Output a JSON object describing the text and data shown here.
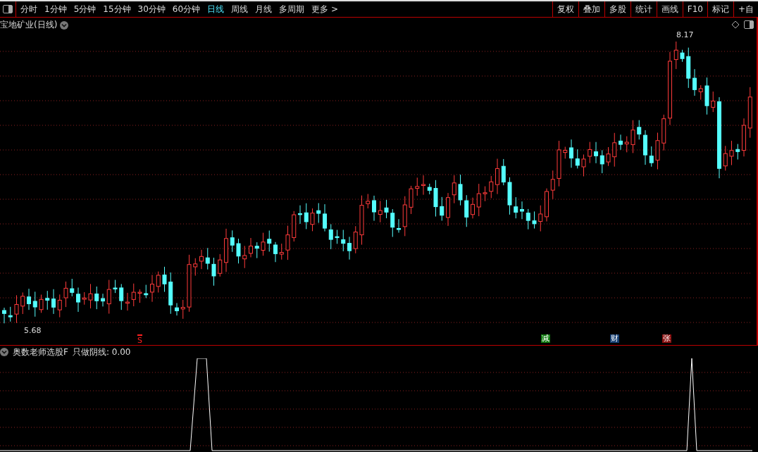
{
  "toolbar": {
    "periods": [
      {
        "label": "分时",
        "selected": false
      },
      {
        "label": "1分钟",
        "selected": false
      },
      {
        "label": "5分钟",
        "selected": false
      },
      {
        "label": "15分钟",
        "selected": false
      },
      {
        "label": "30分钟",
        "selected": false
      },
      {
        "label": "60分钟",
        "selected": false
      },
      {
        "label": "日线",
        "selected": true
      },
      {
        "label": "周线",
        "selected": false
      },
      {
        "label": "月线",
        "selected": false
      },
      {
        "label": "多周期",
        "selected": false
      },
      {
        "label": "更多 >",
        "selected": false
      }
    ],
    "tools": [
      "复权",
      "叠加",
      "多股",
      "统计",
      "画线",
      "F10",
      "标记",
      "+自"
    ]
  },
  "chart": {
    "title": "宝地矿业(日线)",
    "high_label": "8.17",
    "low_label": "5.68",
    "signals": [
      {
        "kind": "arrow",
        "text": "S",
        "color": "#ff2020"
      },
      {
        "kind": "box",
        "text": "减",
        "color": "#0f7a0f"
      },
      {
        "kind": "box",
        "text": "财",
        "color": "#123c70"
      },
      {
        "kind": "box",
        "text": "张",
        "color": "#8a1010"
      }
    ]
  },
  "indicator": {
    "title": "奥数老师选股F",
    "reading": "只做阴线: 0.00"
  }
}
